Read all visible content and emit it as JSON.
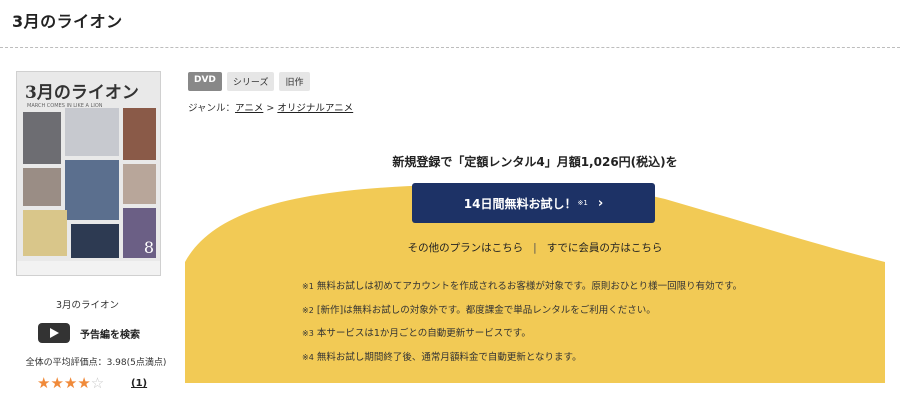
{
  "page": {
    "title": "3月のライオン"
  },
  "cover": {
    "title": "3月のライオン",
    "subtitle": "MARCH COMES IN LIKE A LION",
    "volume": "8"
  },
  "left": {
    "caption": "3月のライオン",
    "trailer_label": "予告編を検索",
    "rating_text": "全体の平均評価点：3.98(5点満点)",
    "stars": {
      "filled": "★★★★",
      "empty": "☆"
    },
    "rating_value": 3.98,
    "review_count": "(1)"
  },
  "tags": [
    "DVD",
    "シリーズ",
    "旧作"
  ],
  "genre": {
    "label": "ジャンル：",
    "items": [
      "アニメ",
      "オリジナルアニメ"
    ],
    "separator": ">"
  },
  "promo": {
    "headline": "新規登録で「定額レンタル4」月額1,026円(税込)を",
    "cta_label": "14日間無料お試し！",
    "cta_sup": "※1",
    "cta_chevron": "›",
    "link_other": "その他のプランはこちら",
    "link_sep": "|",
    "link_member": "すでに会員の方はこちら",
    "notes": [
      {
        "mark": "※1",
        "text": " 無料お試しは初めてアカウントを作成されるお客様が対象です。原則おひとり様一回限り有効です。"
      },
      {
        "mark": "※2",
        "text": " [新作]は無料お試しの対象外です。都度課金で単品レンタルをご利用ください。"
      },
      {
        "mark": "※3",
        "text": " 本サービスは1か月ごとの自動更新サービスです。"
      },
      {
        "mark": "※4",
        "text": " 無料お試し期間終了後、通常月額料金で自動更新となります。"
      }
    ]
  },
  "colors": {
    "accent_yellow": "#f2ca55",
    "cta_navy": "#1d3266",
    "star_orange": "#f08a3a"
  }
}
